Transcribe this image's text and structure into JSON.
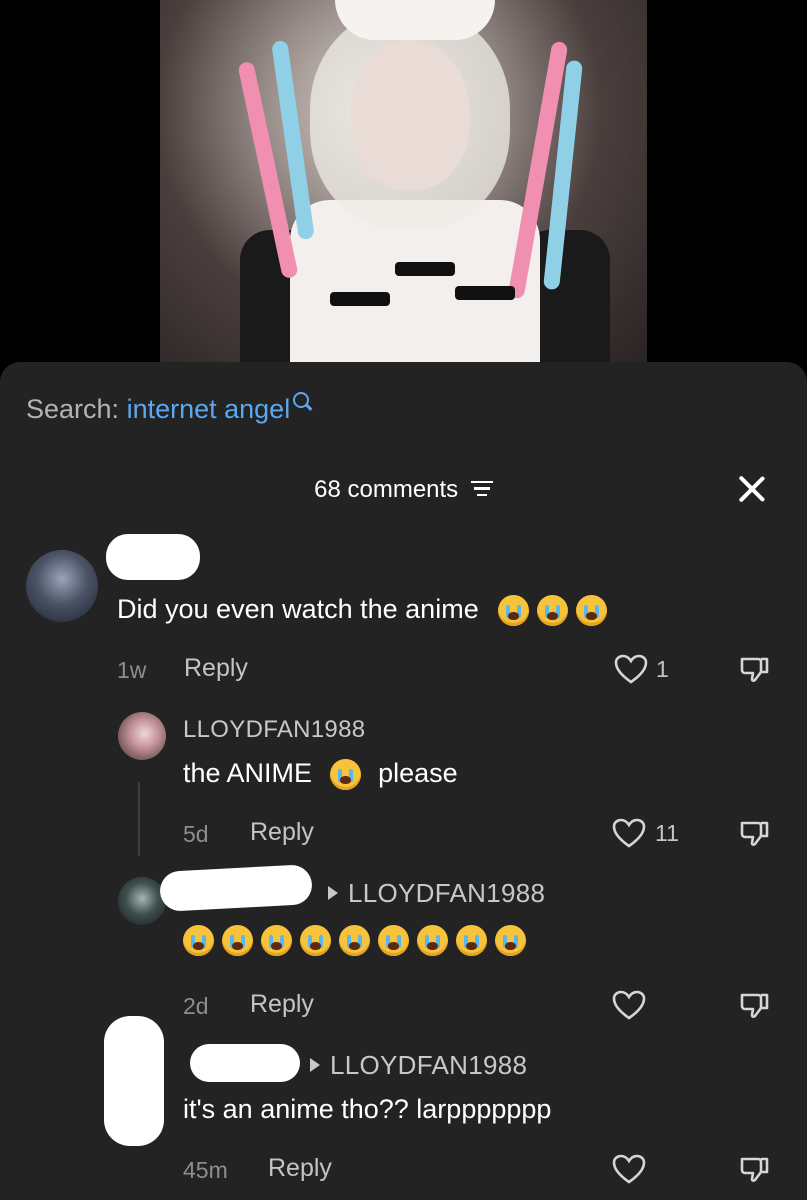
{
  "search": {
    "prefix": "Search:",
    "term": "internet angel"
  },
  "header": {
    "comment_count": "68 comments"
  },
  "comments": [
    {
      "text": "Did you even watch the anime",
      "emoji_count": 3,
      "time": "1w",
      "reply_label": "Reply",
      "likes": "1"
    },
    {
      "username": "LLOYDFAN1988",
      "text_before": "the ANIME",
      "text_after": "please",
      "time": "5d",
      "reply_label": "Reply",
      "likes": "11"
    },
    {
      "reply_to": "LLOYDFAN1988",
      "emoji_count": 9,
      "time": "2d",
      "reply_label": "Reply",
      "likes": ""
    },
    {
      "reply_to": "LLOYDFAN1988",
      "text": "it's an anime tho?? larppppppp",
      "time": "45m",
      "reply_label": "Reply",
      "likes": ""
    }
  ],
  "colors": {
    "accent_link": "#5aa8f0",
    "sheet_bg": "#232323",
    "emoji": "#f6c33b"
  },
  "icons": [
    "search-icon",
    "filter-icon",
    "close-icon",
    "heart-icon",
    "dislike-icon",
    "crying-emoji"
  ]
}
